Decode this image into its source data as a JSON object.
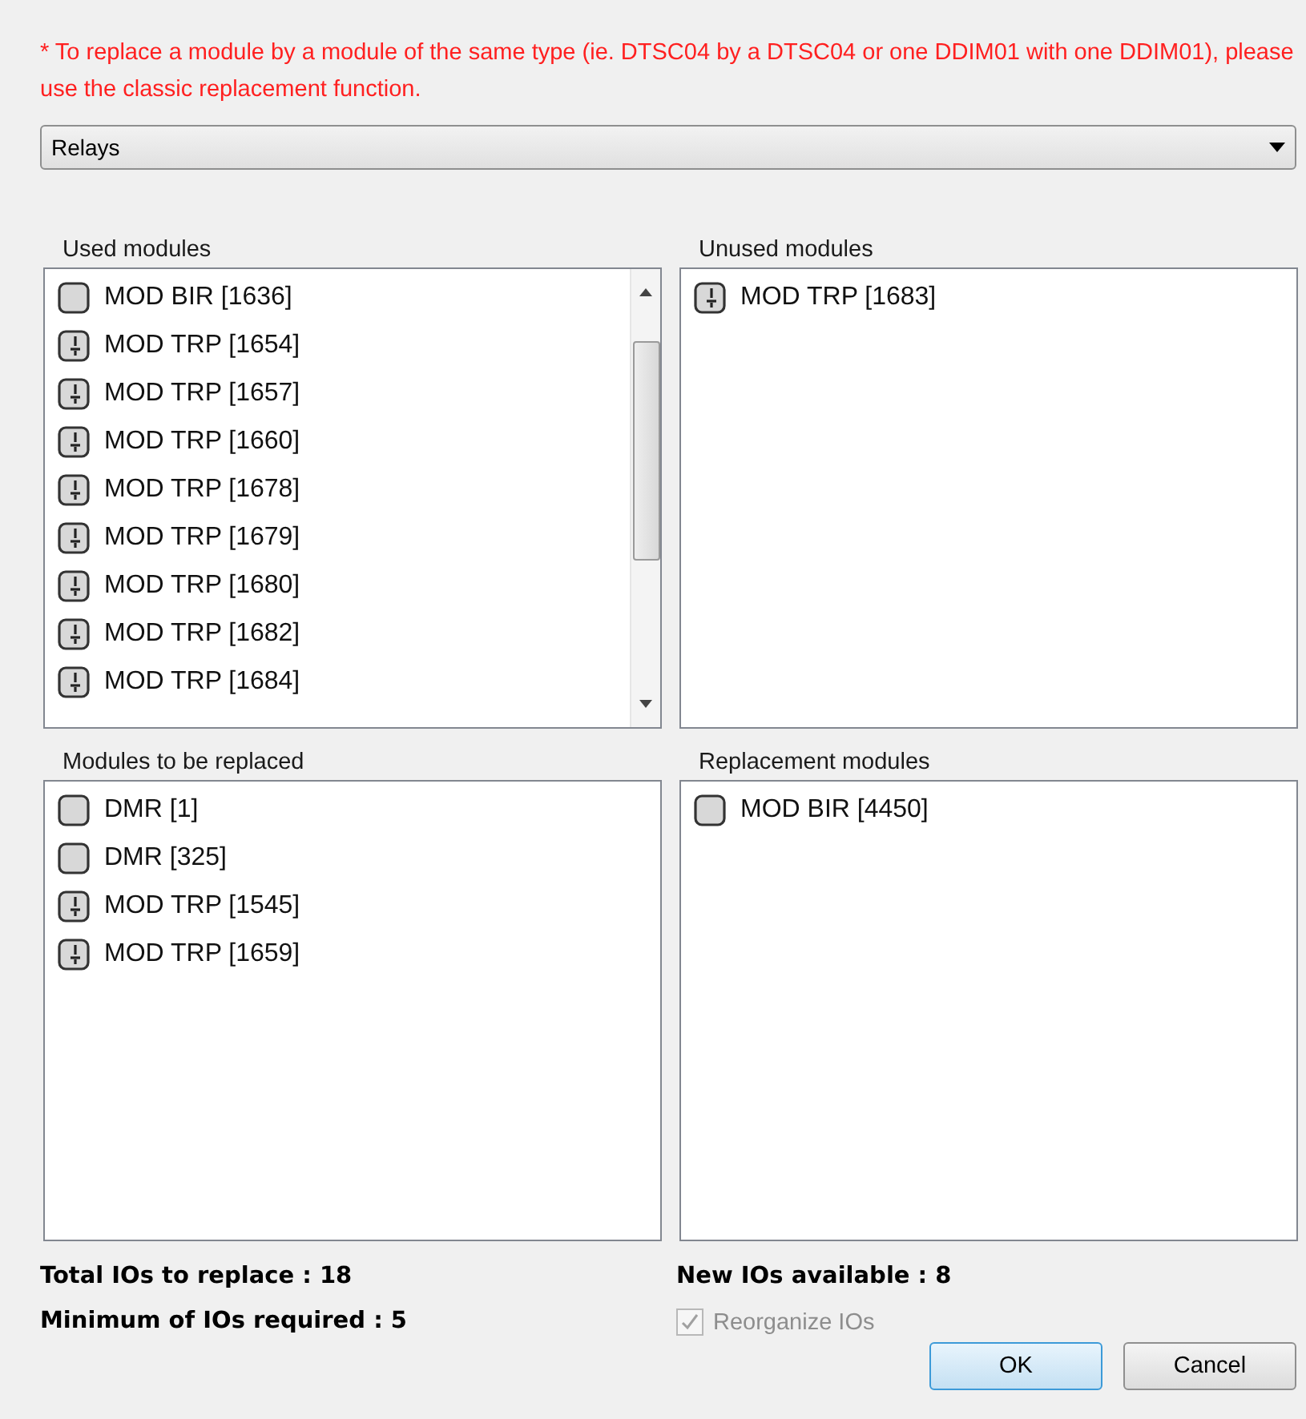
{
  "notice": "* To replace a module by a module of the same type (ie. DTSC04 by a DTSC04 or one DDIM01 with one DDIM01), please use the classic replacement function.",
  "category_dropdown": {
    "value": "Relays"
  },
  "groups": [
    {
      "title": "Used modules",
      "scrollbar": true,
      "items": [
        {
          "kind": "plain",
          "label": "MOD BIR [1636]"
        },
        {
          "kind": "trp",
          "label": "MOD TRP [1654]"
        },
        {
          "kind": "trp",
          "label": "MOD TRP [1657]"
        },
        {
          "kind": "trp",
          "label": "MOD TRP [1660]"
        },
        {
          "kind": "trp",
          "label": "MOD TRP [1678]"
        },
        {
          "kind": "trp",
          "label": "MOD TRP [1679]"
        },
        {
          "kind": "trp",
          "label": "MOD TRP [1680]"
        },
        {
          "kind": "trp",
          "label": "MOD TRP [1682]"
        },
        {
          "kind": "trp",
          "label": "MOD TRP [1684]"
        }
      ]
    },
    {
      "title": "Unused modules",
      "scrollbar": false,
      "items": [
        {
          "kind": "trp",
          "label": "MOD TRP [1683]"
        }
      ]
    },
    {
      "title": "Modules to be replaced",
      "scrollbar": false,
      "items": [
        {
          "kind": "plain",
          "label": "DMR [1]"
        },
        {
          "kind": "plain",
          "label": "DMR [325]"
        },
        {
          "kind": "trp",
          "label": "MOD TRP [1545]"
        },
        {
          "kind": "trp",
          "label": "MOD TRP [1659]"
        }
      ]
    },
    {
      "title": "Replacement modules",
      "scrollbar": false,
      "items": [
        {
          "kind": "plain",
          "label": "MOD BIR [4450]"
        }
      ]
    }
  ],
  "stats": {
    "total": "Total IOs to replace : 18",
    "new": "New IOs available : 8",
    "minimum": "Minimum of IOs required : 5"
  },
  "reorganize": {
    "label": "Reorganize IOs",
    "checked": true,
    "disabled": true
  },
  "buttons": [
    {
      "label": "OK",
      "default": true
    },
    {
      "label": "Cancel",
      "default": false
    }
  ]
}
